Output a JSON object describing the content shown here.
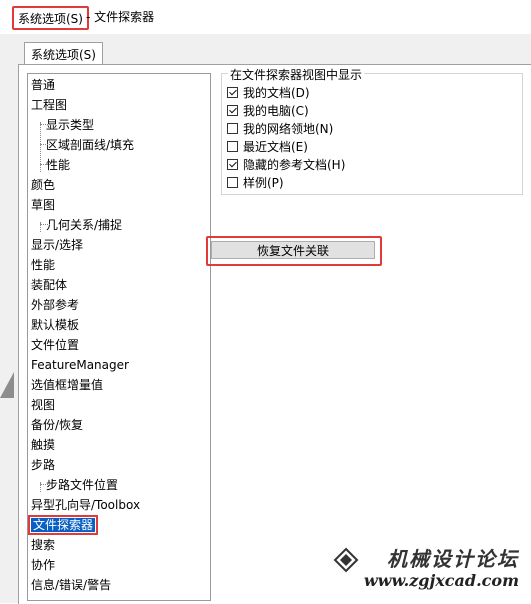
{
  "window": {
    "title_highlight": "系统选项(S)",
    "title_rest": "- 文件探索器"
  },
  "tab": {
    "label": "系统选项(S)"
  },
  "tree": {
    "items": [
      {
        "label": "普通",
        "level": 0
      },
      {
        "label": "工程图",
        "level": 0
      },
      {
        "label": "显示类型",
        "level": 1
      },
      {
        "label": "区域剖面线/填充",
        "level": 1
      },
      {
        "label": "性能",
        "level": 1
      },
      {
        "label": "颜色",
        "level": 0
      },
      {
        "label": "草图",
        "level": 0
      },
      {
        "label": "几何关系/捕捉",
        "level": 1
      },
      {
        "label": "显示/选择",
        "level": 0
      },
      {
        "label": "性能",
        "level": 0
      },
      {
        "label": "装配体",
        "level": 0
      },
      {
        "label": "外部参考",
        "level": 0
      },
      {
        "label": "默认模板",
        "level": 0
      },
      {
        "label": "文件位置",
        "level": 0
      },
      {
        "label": "FeatureManager",
        "level": 0
      },
      {
        "label": "选值框增量值",
        "level": 0
      },
      {
        "label": "视图",
        "level": 0
      },
      {
        "label": "备份/恢复",
        "level": 0
      },
      {
        "label": "触摸",
        "level": 0
      },
      {
        "label": "步路",
        "level": 0
      },
      {
        "label": "步路文件位置",
        "level": 1
      },
      {
        "label": "异型孔向导/Toolbox",
        "level": 0
      },
      {
        "label": "文件探索器",
        "level": 0,
        "selected": true
      },
      {
        "label": "搜索",
        "level": 0
      },
      {
        "label": "协作",
        "level": 0
      },
      {
        "label": "信息/错误/警告",
        "level": 0
      }
    ]
  },
  "group": {
    "title": "在文件探索器视图中显示",
    "options": [
      {
        "label": "我的文档(D)",
        "checked": true
      },
      {
        "label": "我的电脑(C)",
        "checked": true
      },
      {
        "label": "我的网络领地(N)",
        "checked": false
      },
      {
        "label": "最近文档(E)",
        "checked": false
      },
      {
        "label": "隐藏的参考文档(H)",
        "checked": true
      },
      {
        "label": "样例(P)",
        "checked": false
      }
    ]
  },
  "reset_button": {
    "label": "恢复文件关联"
  },
  "watermark": {
    "title": "机械设计论坛",
    "url": "www.zgjxcad.com"
  },
  "colors": {
    "highlight_border": "#e23a3a",
    "selection": "#0a5fc5"
  }
}
